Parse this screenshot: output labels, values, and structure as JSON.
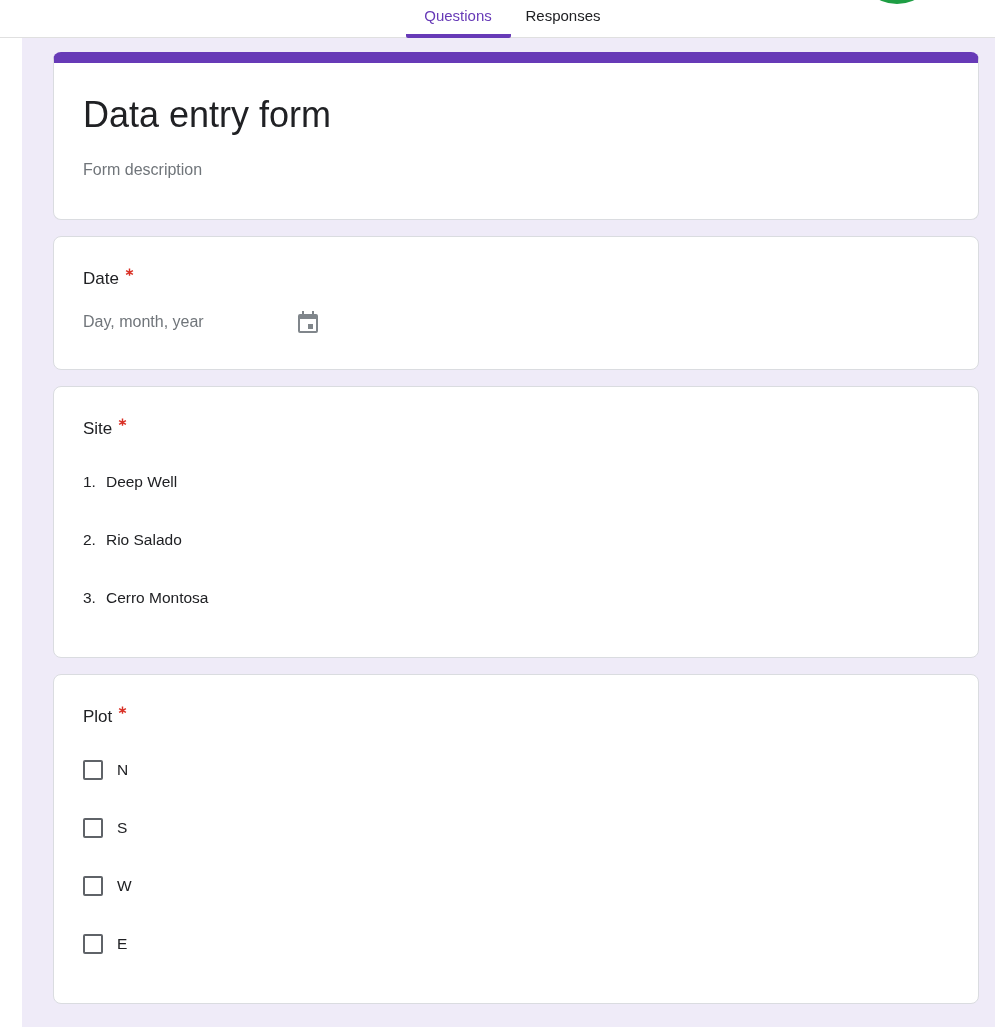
{
  "tabs": [
    {
      "label": "Questions",
      "selected": true
    },
    {
      "label": "Responses",
      "selected": false
    }
  ],
  "header": {
    "title": "Data entry form",
    "description": "Form description"
  },
  "questions": [
    {
      "kind": "date",
      "title": "Date",
      "required": true,
      "placeholder": "Day, month, year"
    },
    {
      "kind": "list",
      "title": "Site",
      "required": true,
      "items": [
        {
          "number": "1.",
          "label": "Deep Well"
        },
        {
          "number": "2.",
          "label": "Rio Salado"
        },
        {
          "number": "3.",
          "label": "Cerro Montosa"
        }
      ]
    },
    {
      "kind": "checkboxes",
      "title": "Plot",
      "required": true,
      "options": [
        {
          "label": "N",
          "checked": false
        },
        {
          "label": "S",
          "checked": false
        },
        {
          "label": "W",
          "checked": false
        },
        {
          "label": "E",
          "checked": false
        }
      ]
    }
  ]
}
